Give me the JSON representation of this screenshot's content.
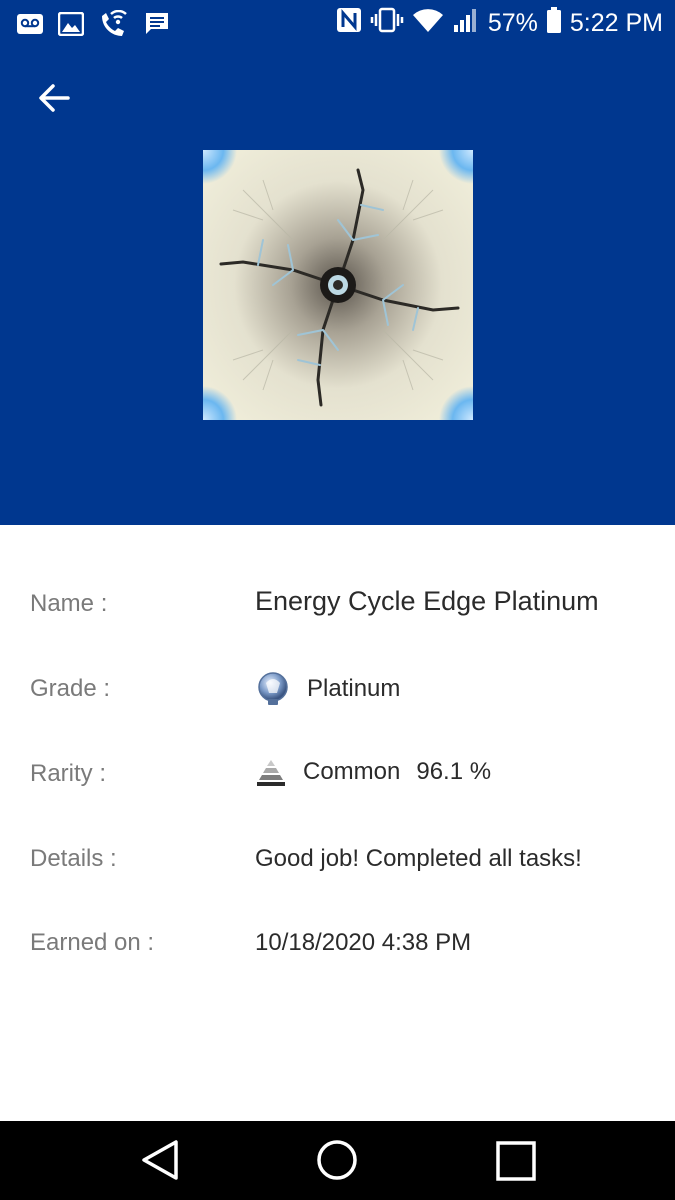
{
  "status_bar": {
    "battery": "57%",
    "time": "5:22 PM",
    "left_icons": [
      "voicemail-icon",
      "image-icon",
      "wifi-calling-icon",
      "message-icon"
    ],
    "right_icons": [
      "nfc-icon",
      "vibrate-icon",
      "wifi-icon",
      "signal-icon",
      "battery-icon"
    ]
  },
  "colors": {
    "header_bg": "#00378f",
    "label": "#7a7a7a",
    "value": "#2b2b2b",
    "nav_bg": "#000000"
  },
  "header": {
    "back_icon": "arrow-left-icon",
    "trophy_image": "fractal-trophy-artwork"
  },
  "details": {
    "name_label": "Name :",
    "name_value": "Energy Cycle Edge Platinum",
    "grade_label": "Grade :",
    "grade_value": "Platinum",
    "grade_icon": "platinum-trophy-icon",
    "rarity_label": "Rarity :",
    "rarity_value": "Common",
    "rarity_percent": "96.1 %",
    "rarity_icon": "pyramid-icon",
    "details_label": "Details :",
    "details_value": "Good job! Completed all tasks!",
    "earned_label": "Earned on :",
    "earned_value": "10/18/2020 4:38 PM"
  },
  "nav_bar": {
    "back": "nav-back-icon",
    "home": "nav-home-icon",
    "recents": "nav-recents-icon"
  }
}
